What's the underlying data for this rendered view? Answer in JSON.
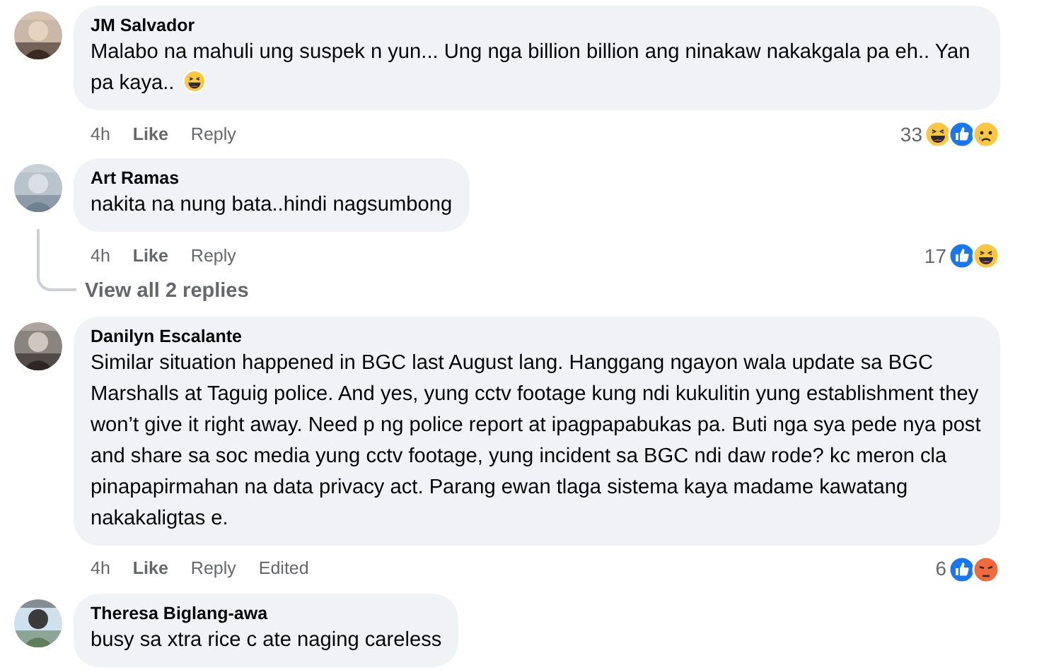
{
  "comments": [
    {
      "author": "JM Salvador",
      "text": "Malabo na mahuli ung suspek n yun... Ung nga billion billion ang ninakaw nakakgala pa eh.. Yan pa kaya..",
      "has_emoji": true,
      "time": "4h",
      "like": "Like",
      "reply": "Reply",
      "reaction_count": "33",
      "reactions": [
        {
          "kind": "haha"
        },
        {
          "kind": "like"
        },
        {
          "kind": "sad"
        }
      ],
      "reply_thread": false
    },
    {
      "author": "Art Ramas",
      "text": "nakita na nung bata..hindi nagsumbong",
      "time": "4h",
      "like": "Like",
      "reply": "Reply",
      "reaction_count": "17",
      "reactions": [
        {
          "kind": "like"
        },
        {
          "kind": "haha"
        }
      ],
      "reply_thread": true,
      "view_replies": "View all 2 replies"
    },
    {
      "author": "Danilyn Escalante",
      "text": "Similar situation happened in BGC last August lang. Hanggang ngayon wala update sa BGC Marshalls at Taguig police. And yes, yung cctv footage kung ndi kukulitin yung establishment they won’t give it right away. Need p ng police report at ipagpapabukas pa. Buti nga sya pede nya post and share sa soc media yung cctv footage, yung incident sa BGC ndi daw rode? kc meron cla pinapapirmahan na data privacy act. Parang ewan tlaga sistema kaya madame kawatang nakakaligtas e.",
      "time": "4h",
      "like": "Like",
      "reply": "Reply",
      "edited": "Edited",
      "reaction_count": "6",
      "reactions": [
        {
          "kind": "like"
        },
        {
          "kind": "angry"
        }
      ],
      "reply_thread": false
    },
    {
      "author": "Theresa Biglang-awa",
      "text": "busy sa xtra rice c ate naging careless",
      "reply_thread": false
    }
  ]
}
